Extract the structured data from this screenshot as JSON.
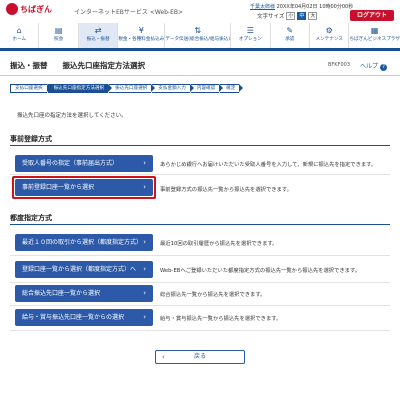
{
  "header": {
    "logo_text": "ちばぎん",
    "service_name": "インターネットEBサービス <Web-EB>",
    "user_name": "千葉太郎様",
    "last_login": "20XX年04月02日 10時00分00秒",
    "font_size_label": "文字サイズ",
    "font_sizes": [
      "小",
      "中",
      "大"
    ],
    "logout_label": "ログアウト"
  },
  "nav": {
    "items": [
      {
        "label": "ホーム",
        "icon": "home-icon",
        "glyph": "⌂"
      },
      {
        "label": "照会",
        "icon": "inquiry-icon",
        "glyph": "▤"
      },
      {
        "label": "振込・振替",
        "icon": "transfer-icon",
        "glyph": "⇄"
      },
      {
        "label": "税金・各種料金払込み",
        "icon": "tax-payment-icon",
        "glyph": "¥"
      },
      {
        "label": "データ伝送(総合振込/給与振込)",
        "icon": "data-transfer-icon",
        "glyph": "⇅"
      },
      {
        "label": "オプション",
        "icon": "option-icon",
        "glyph": "☰"
      },
      {
        "label": "承認",
        "icon": "approval-icon",
        "glyph": "✎"
      },
      {
        "label": "メンテナンス",
        "icon": "maintenance-icon",
        "glyph": "⚙"
      },
      {
        "label": "ちばぎんビジネスプラザ",
        "icon": "business-plaza-icon",
        "glyph": "▦"
      }
    ],
    "active_index": 2
  },
  "page": {
    "title": "振込・振替　　振込先口座指定方法選択",
    "screen_id": "BFKF003",
    "help_label": "ヘルプ"
  },
  "steps": [
    "支払口座選択",
    "振込先口座指定方法選択",
    "振込先口座選択",
    "支払金額入力",
    "内容確認",
    "確定"
  ],
  "instruction": "振込先口座の指定方法を選択してください。",
  "section1": {
    "title": "事前登録方式",
    "rows": [
      {
        "label": "受取人番号の指定（事前届出方式）",
        "desc": "あらかじめ銀行へお届けいただいた受取人番号を入力して、新規に振込先を指定できます。"
      },
      {
        "label": "事前登録口座一覧から選択",
        "desc": "事前登録方式の振込先一覧から振込先を選択できます。"
      }
    ]
  },
  "section2": {
    "title": "都度指定方式",
    "rows": [
      {
        "label": "最近１０回の取引から選択（都度指定方式）",
        "desc": "最近10回の取引履歴から振込先を選択できます。"
      },
      {
        "label": "登録口座一覧から選択（都度指定方式）へ",
        "desc": "Web-EBへご登録いただいた都度指定方式の振込先一覧から振込先を選択できます。"
      },
      {
        "label": "総合振込先口座一覧から選択",
        "desc": "総合振込先一覧から振込先を選択できます。"
      },
      {
        "label": "給与・賞与振込先口座一覧からの選択",
        "desc": "給与・賞与振込先一覧から振込先を選択できます。"
      }
    ]
  },
  "back_label": "戻る",
  "colors": {
    "brand_red": "#c8102e",
    "primary_blue": "#2d5aa8",
    "nav_blue": "#1a4f93",
    "highlight_red": "#d0121b"
  }
}
